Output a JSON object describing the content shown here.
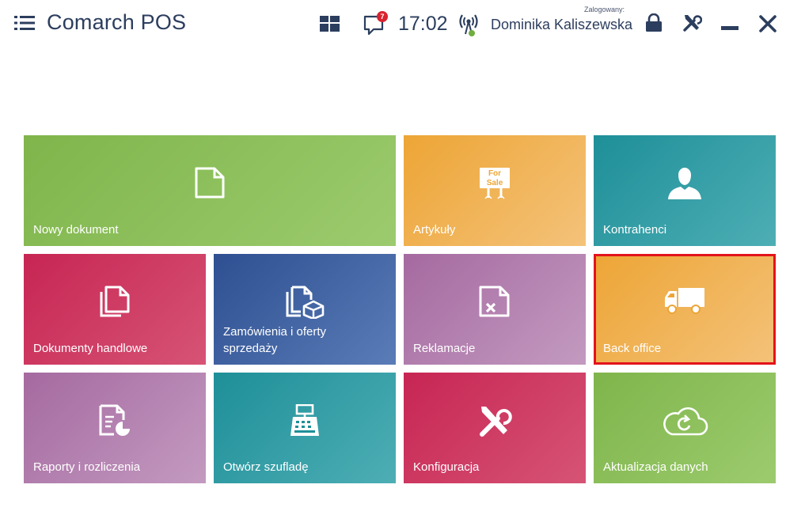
{
  "header": {
    "app_title": "Comarch POS",
    "notification_count": "7",
    "time": "17:02",
    "logged_label": "Zalogowany:",
    "user_name": "Dominika Kaliszewska"
  },
  "tiles": [
    {
      "label": "Nowy dokument",
      "icon": "new-document-icon",
      "color": "#7fb54b"
    },
    {
      "label": "Artykuły",
      "icon": "for-sale-sign-icon",
      "color": "#eda535"
    },
    {
      "label": "Kontrahenci",
      "icon": "person-icon",
      "color": "#1e8f98"
    },
    {
      "label": "Dokumenty handlowe",
      "icon": "documents-icon",
      "color": "#c72553"
    },
    {
      "label": "Zamówienia i oferty sprzedaży",
      "icon": "documents-box-icon",
      "color": "#2e4f91"
    },
    {
      "label": "Reklamacje",
      "icon": "document-x-icon",
      "color": "#a56aa0"
    },
    {
      "label": "Back office",
      "icon": "truck-icon",
      "color": "#eda535",
      "selected": true
    },
    {
      "label": "Raporty i rozliczenia",
      "icon": "report-chart-icon",
      "color": "#a56aa0"
    },
    {
      "label": "Otwórz szufladę",
      "icon": "cash-register-icon",
      "color": "#1e8f98"
    },
    {
      "label": "Konfiguracja",
      "icon": "tools-icon",
      "color": "#c72553"
    },
    {
      "label": "Aktualizacja danych",
      "icon": "cloud-sync-icon",
      "color": "#7fb54b"
    }
  ]
}
